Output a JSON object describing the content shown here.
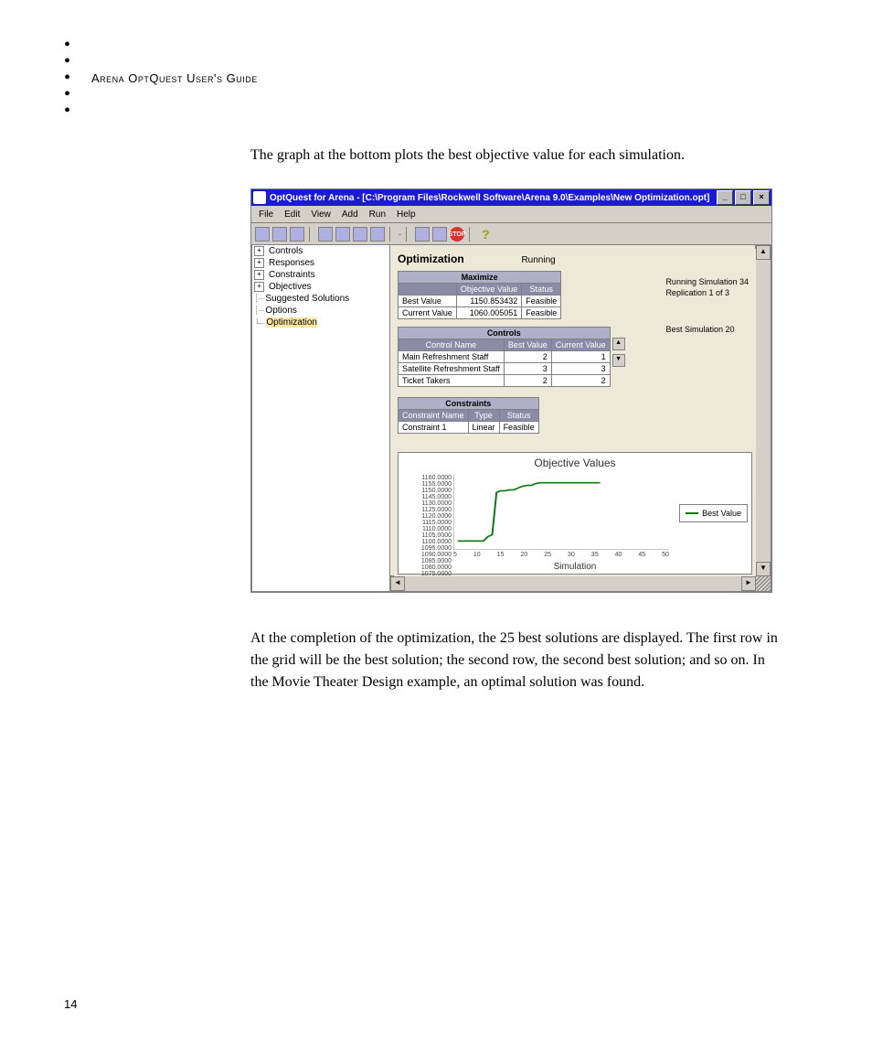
{
  "doc": {
    "header_guide": "Arena OptQuest User's Guide",
    "para1": "The graph at the bottom plots the best objective value for each simulation.",
    "para2": "At the completion of the optimization, the 25 best solutions are displayed. The first row in the grid will be the best solution; the second row, the second best solution; and so on. In the Movie Theater Design example, an optimal solution was found.",
    "page_number": "14"
  },
  "window": {
    "title": "OptQuest for Arena - [C:\\Program Files\\Rockwell Software\\Arena 9.0\\Examples\\New Optimization.opt]",
    "menus": [
      "File",
      "Edit",
      "View",
      "Add",
      "Run",
      "Help"
    ],
    "stop_label": "STOP",
    "help_symbol": "?"
  },
  "tree": {
    "items": [
      {
        "label": "Controls",
        "expand": "+"
      },
      {
        "label": "Responses",
        "expand": "+"
      },
      {
        "label": "Constraints",
        "expand": "+"
      },
      {
        "label": "Objectives",
        "expand": "+"
      },
      {
        "label": "Suggested Solutions",
        "indent": true
      },
      {
        "label": "Options",
        "indent": true
      },
      {
        "label": "Optimization",
        "indent": true,
        "selected": true
      }
    ]
  },
  "panel": {
    "heading": "Optimization",
    "status": "Running",
    "side_line1": "Running Simulation 34",
    "side_line2": "Replication 1 of 3",
    "side_line3": "Best Simulation 20",
    "maximize": {
      "caption": "Maximize",
      "cols": [
        "",
        "Objective Value",
        "Status"
      ],
      "rows": [
        {
          "name": "Best Value",
          "val": "1150.853432",
          "status": "Feasible"
        },
        {
          "name": "Current Value",
          "val": "1060.005051",
          "status": "Feasible"
        }
      ]
    },
    "controls_tbl": {
      "caption": "Controls",
      "cols": [
        "Control Name",
        "Best Value",
        "Current Value"
      ],
      "rows": [
        {
          "name": "Main Refreshment Staff",
          "best": "2",
          "cur": "1"
        },
        {
          "name": "Satellite Refreshment Staff",
          "best": "3",
          "cur": "3"
        },
        {
          "name": "Ticket Takers",
          "best": "2",
          "cur": "2"
        }
      ]
    },
    "constraints_tbl": {
      "caption": "Constraints",
      "cols": [
        "Constraint Name",
        "Type",
        "Status"
      ],
      "rows": [
        {
          "name": "Constraint 1",
          "type": "Linear",
          "status": "Feasible"
        }
      ]
    }
  },
  "chart_data": {
    "type": "line",
    "title": "Objective Values",
    "xlabel": "Simulation",
    "ylabel": "",
    "x_ticks": [
      "5",
      "10",
      "15",
      "20",
      "25",
      "30",
      "35",
      "40",
      "45",
      "50"
    ],
    "y_ticks": [
      "1160.0000",
      "1155.0000",
      "1150.0000",
      "1145.0000",
      "1130.0000",
      "1125.0000",
      "1120.0000",
      "1115.0000",
      "1110.0000",
      "1105.0000",
      "1100.0000",
      "1095.0000",
      "1090.0000",
      "1085.0000",
      "1080.0000",
      "1075.0000"
    ],
    "ylim": [
      1075,
      1160
    ],
    "xlim": [
      0,
      50
    ],
    "series": [
      {
        "name": "Best Value",
        "color": "#0a7a0a",
        "x": [
          1,
          2,
          3,
          4,
          5,
          6,
          7,
          8,
          9,
          10,
          11,
          12,
          13,
          14,
          15,
          16,
          17,
          18,
          19,
          20,
          25,
          30,
          34
        ],
        "values": [
          1085,
          1085,
          1085,
          1085,
          1085,
          1085,
          1085,
          1090,
          1092,
          1140,
          1142,
          1142,
          1143,
          1143,
          1145,
          1147,
          1148,
          1148,
          1150,
          1151,
          1151,
          1151,
          1151
        ]
      }
    ]
  }
}
